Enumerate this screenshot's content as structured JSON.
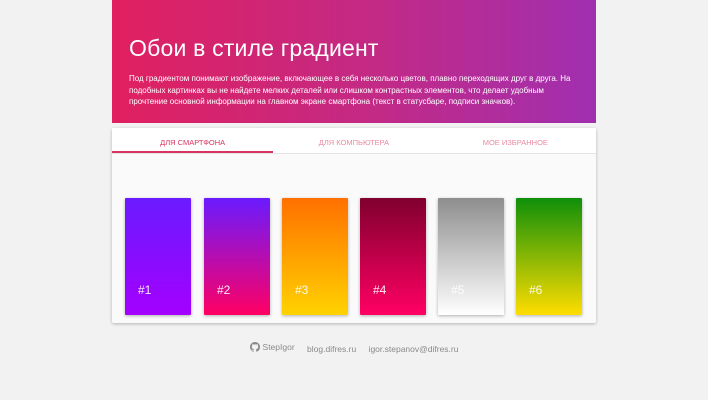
{
  "hero": {
    "title": "Обои в стиле градиент",
    "description": "Под градиентом понимают изображение, включающее в себя несколько цветов, плавно переходящих друг в друга. На подобных картинках вы не найдете мелких деталей или слишком контрастных элементов, что делает удобным прочтение основной информации на главном экране смартфона (текст в статусбаре, подписи значков).",
    "colors": {
      "start": "#e0205f",
      "end": "#a02fb0"
    }
  },
  "tabs": [
    {
      "label": "Для смартфона",
      "active": true
    },
    {
      "label": "Для компьютера",
      "active": false
    },
    {
      "label": "Мое избранное",
      "active": false
    }
  ],
  "wallpapers": [
    {
      "label": "#1",
      "from": "#6a1bff",
      "to": "#a400ff"
    },
    {
      "label": "#2",
      "from": "#6a1bff",
      "to": "#ff0063"
    },
    {
      "label": "#3",
      "from": "#ff7000",
      "to": "#ffd200"
    },
    {
      "label": "#4",
      "from": "#80002e",
      "to": "#ff0064"
    },
    {
      "label": "#5",
      "from": "#8e8e8e",
      "to": "#ffffff"
    },
    {
      "label": "#6",
      "from": "#0f8f0a",
      "to": "#ffdd00"
    }
  ],
  "footer": {
    "github": "StepIgor",
    "github_icon": "github-icon",
    "blog": "blog.difres.ru",
    "email": "igor.stepanov@difres.ru"
  }
}
